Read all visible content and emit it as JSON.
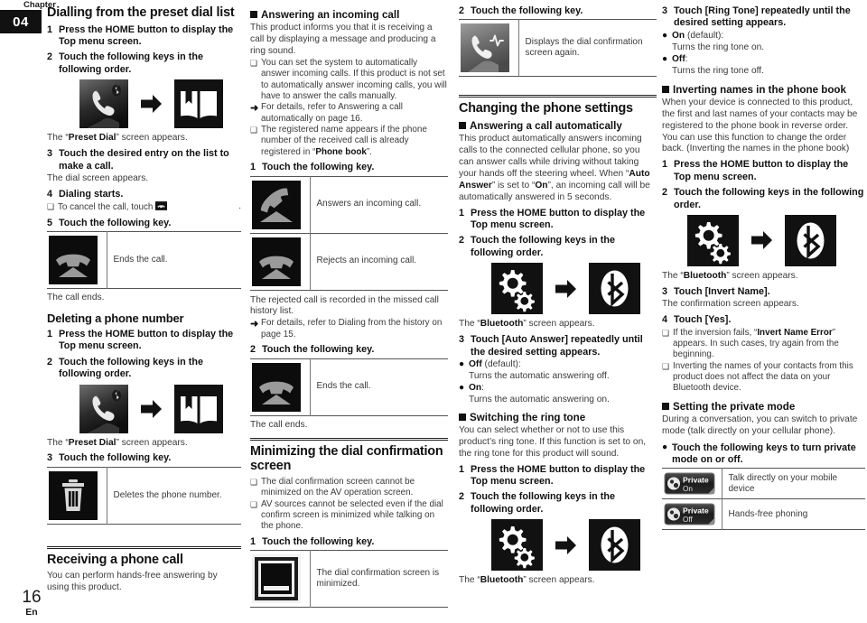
{
  "chapter": {
    "label": "Chapter",
    "number": "04"
  },
  "folio": {
    "page": "16",
    "lang": "En"
  },
  "col1": {
    "title": "Dialling from the preset dial list",
    "step1_n": "1",
    "step1_t": "Press the HOME button to display the Top menu screen.",
    "step2_n": "2",
    "step2_t": "Touch the following keys in the following order.",
    "after_icons_1": "The “Preset Dial” screen appears.",
    "after_icons_1_pre": "The “",
    "after_icons_1_bold": "Preset Dial",
    "after_icons_1_post": "” screen appears.",
    "step3_n": "3",
    "step3_t": "Touch the desired entry on the list to make a call.",
    "dial_screen_appears": "The dial screen appears.",
    "step4_n": "4",
    "step4_t": "Dialing starts.",
    "note_cancel_pre": "To cancel the call, touch ",
    "note_cancel_post": ".",
    "step5_n": "5",
    "step5_t": "Touch the following key.",
    "ends_the_call": "Ends the call.",
    "the_call_ends": "The call ends.",
    "delete_title": "Deleting a phone number",
    "d_step1_n": "1",
    "d_step1_t": "Press the HOME button to display the Top menu screen.",
    "d_step2_n": "2",
    "d_step2_t": "Touch the following keys in the following order.",
    "d_after_pre": "The “",
    "d_after_bold": "Preset Dial",
    "d_after_post": "” screen appears.",
    "d_step3_n": "3",
    "d_step3_t": "Touch the following key.",
    "deletes_number": "Deletes the phone number.",
    "receiving_title": "Receiving a phone call",
    "receiving_body": "You can perform hands-free answering by using this product."
  },
  "col2": {
    "sub_title": "Answering an incoming call",
    "intro": "This product informs you that it is receiving a call by displaying a message and producing a ring sound.",
    "note1": "You can set the system to automatically answer incoming calls. If this product is not set to automatically answer incoming calls, you will have to answer the calls manually.",
    "note2": "For details, refer to Answering a call automatically on page 16.",
    "note3_pre": "The registered name appears if the phone number of the received call is already registered in “",
    "note3_bold": "Phone book",
    "note3_post": "”.",
    "step1_n": "1",
    "step1_t": "Touch the following key.",
    "answers_call": "Answers an incoming call.",
    "rejects_call": "Rejects an incoming call.",
    "rejected_body": "The rejected call is recorded in the missed call history list.",
    "rejected_note": "For details, refer to Dialing from the history on page 15.",
    "step2_n": "2",
    "step2_t": "Touch the following key.",
    "ends_the_call": "Ends the call.",
    "the_call_ends": "The call ends.",
    "min_title": "Minimizing the dial confirmation screen",
    "min_note1": "The dial confirmation screen cannot be minimized on the AV operation screen.",
    "min_note2": "AV sources cannot be selected even if the dial confirm screen is minimized while talking on the phone.",
    "min_step1_n": "1",
    "min_step1_t": "Touch the following key.",
    "min_desc": "The dial confirmation screen is minimized."
  },
  "col3": {
    "step2_n": "2",
    "step2_t": "Touch the following key.",
    "displays_again": "Displays the dial confirmation screen again.",
    "title": "Changing the phone settings",
    "sub_title": "Answering a call automatically",
    "intro_pre": "This product automatically answers incoming calls to the connected cellular phone, so you can answer calls while driving without taking your hands off the steering wheel. When “",
    "intro_b1": "Auto Answer",
    "intro_mid": "” is set to “",
    "intro_b2": "On",
    "intro_post": "”, an incoming call will be automatically answered in 5 seconds.",
    "step1_n": "1",
    "step1_t": "Press the HOME button to display the Top menu screen.",
    "step2b_n": "2",
    "step2b_t": "Touch the following keys in the following order.",
    "bt_pre": "The “",
    "bt_bold": "Bluetooth",
    "bt_post": "” screen appears.",
    "step3_n": "3",
    "step3_t": "Touch [Auto Answer] repeatedly until the desired setting appears.",
    "opt_off_label": "Off",
    "opt_off_paren": " (default):",
    "opt_off_desc": "Turns the automatic answering off.",
    "opt_on_label": "On",
    "opt_on_paren": ":",
    "opt_on_desc": "Turns the automatic answering on.",
    "ring_sub_title": "Switching the ring tone",
    "ring_body": "You can select whether or not to use this product’s ring tone. If this function is set to on, the ring tone for this product will sound.",
    "r_step1_n": "1",
    "r_step1_t": "Press the HOME button to display the Top menu screen.",
    "r_step2_n": "2",
    "r_step2_t": "Touch the following keys in the following order.",
    "r_bt_pre": "The “",
    "r_bt_bold": "Bluetooth",
    "r_bt_post": "” screen appears."
  },
  "col4": {
    "step3_n": "3",
    "step3_t": "Touch [Ring Tone] repeatedly until the desired setting appears.",
    "opt_on_label": "On",
    "opt_on_paren": " (default):",
    "opt_on_desc": "Turns the ring tone on.",
    "opt_off_label": "Off",
    "opt_off_paren": ":",
    "opt_off_desc": "Turns the ring tone off.",
    "invert_sub_title": "Inverting names in the phone book",
    "invert_body": "When your device is connected to this product, the first and last names of your contacts may be registered to the phone book in reverse order. You can use this function to change the order back. (Inverting the names in the phone book)",
    "step1_n": "1",
    "step1_t": "Press the HOME button to display the Top menu screen.",
    "step2_n": "2",
    "step2_t": "Touch the following keys in the following order.",
    "bt_pre": "The “",
    "bt_bold": "Bluetooth",
    "bt_post": "” screen appears.",
    "i_step3_n": "3",
    "i_step3_t": "Touch [Invert Name].",
    "confirm_appears": "The confirmation screen appears.",
    "i_step4_n": "4",
    "i_step4_t": "Touch [Yes].",
    "i_note1_pre": "If the inversion fails, “",
    "i_note1_bold": "Invert Name Error",
    "i_note1_post": "” appears. In such cases, try again from the beginning.",
    "i_note2": "Inverting the names of your contacts from this product does not affect the data on your Bluetooth device.",
    "priv_sub_title": "Setting the private mode",
    "priv_body": "During a conversation, you can switch to private mode (talk directly on your cellular phone).",
    "priv_bullet": "Touch the following keys to turn private mode on or off.",
    "priv_on_l1": "Private",
    "priv_on_l2": "On",
    "priv_on_desc": "Talk directly on your mobile device",
    "priv_off_l1": "Private",
    "priv_off_l2": "Off",
    "priv_off_desc": "Hands-free phoning"
  },
  "icons": {
    "phone_bt": "phone-bluetooth-icon",
    "phonebook": "phonebook-icon",
    "arrow": "arrow-right-icon",
    "hangup": "hangup-icon",
    "answer": "answer-call-icon",
    "trash": "trash-icon",
    "minimize": "minimize-screen-icon",
    "restore": "restore-dial-icon",
    "settings": "settings-gears-icon",
    "bluetooth": "bluetooth-icon",
    "private_on": "private-on-icon",
    "private_off": "private-off-icon"
  },
  "colors": {
    "ink": "#1a1a1a",
    "body": "#3a3a3a",
    "rule": "#555555",
    "tile_dark": "#101010"
  }
}
